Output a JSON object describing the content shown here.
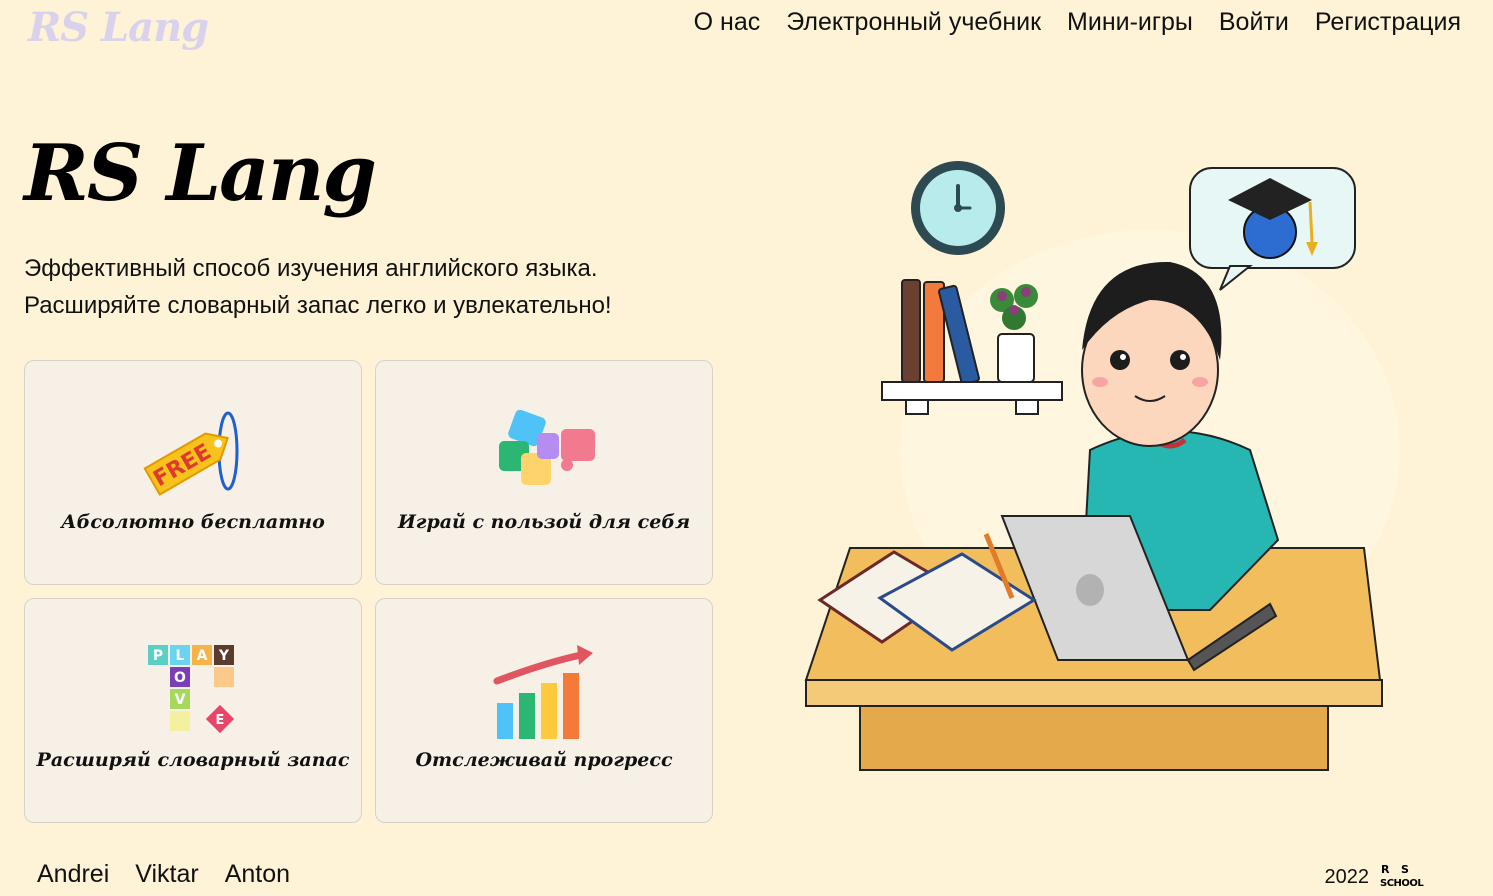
{
  "header": {
    "logo": "RS Lang",
    "nav": [
      "О нас",
      "Электронный учебник",
      "Мини-игры",
      "Войти",
      "Регистрация"
    ]
  },
  "hero": {
    "title": "RS Lang",
    "subtitle_lines": [
      "Эффективный способ изучения английского языка.",
      "Расширяйте словарный запас легко и увлекательно!"
    ]
  },
  "features": [
    {
      "label": "Абсолютно бесплатно",
      "icon": "free-tag-icon"
    },
    {
      "label": "Играй с пользой для себя",
      "icon": "puzzle-icon"
    },
    {
      "label": "Расширяй словарный запас",
      "icon": "letter-blocks-icon"
    },
    {
      "label": "Отслеживай прогресс",
      "icon": "progress-chart-icon"
    }
  ],
  "footer": {
    "authors": [
      "Andrei",
      "Viktar",
      "Anton"
    ],
    "year": "2022",
    "school_logo": "RS SCHOOL"
  },
  "colors": {
    "background": "#fef3d6",
    "card": "#f6f0e6",
    "logo": "#d9d2ec"
  }
}
